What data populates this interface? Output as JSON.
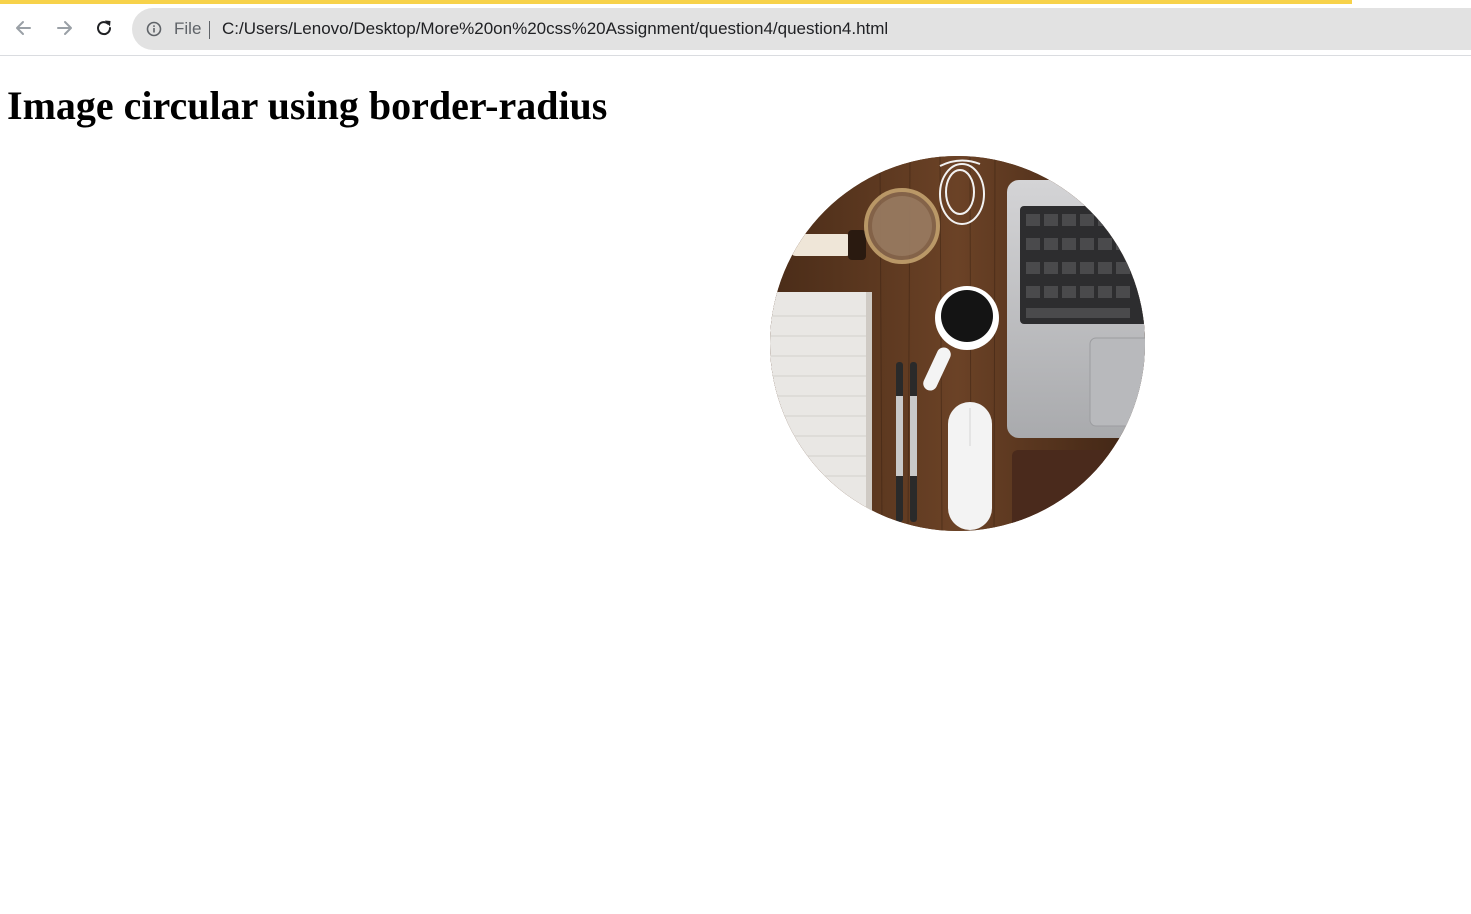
{
  "browser": {
    "loading_bar_color": "#f7d24a",
    "back_icon": "arrow-left-icon",
    "forward_icon": "arrow-right-icon",
    "reload_icon": "reload-icon",
    "info_icon": "info-circle-icon",
    "scheme_label": "File",
    "url": "C:/Users/Lenovo/Desktop/More%20on%20css%20Assignment/question4/question4.html"
  },
  "page": {
    "heading": "Image circular using border-radius",
    "image": {
      "shape": "circle",
      "subject": "desk-flatlay-photo"
    }
  }
}
